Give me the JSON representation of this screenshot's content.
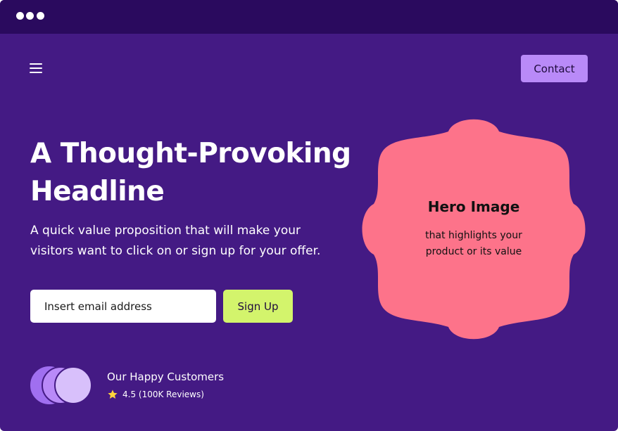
{
  "colors": {
    "page_background": "#441a84",
    "titlebar": "#2a0a5e",
    "contact_button": "#b98af8",
    "signup_button": "#d3f46c",
    "hero_shape": "#fd738a",
    "star": "#ffd43b"
  },
  "icons": {
    "menu": "hamburger-menu-icon",
    "rating": "star-icon"
  },
  "nav": {
    "contact_label": "Contact"
  },
  "hero": {
    "headline": "A Thought-Provoking Headline",
    "subheadline": "A quick value proposition that will make your visitors want to click on or sign up for your offer.",
    "email_placeholder": "Insert email address",
    "signup_label": "Sign Up",
    "image_title": "Hero Image",
    "image_caption": "that highlights your product or its value"
  },
  "social_proof": {
    "title": "Our Happy Customers",
    "rating_text": "4.5 (100K Reviews)"
  }
}
